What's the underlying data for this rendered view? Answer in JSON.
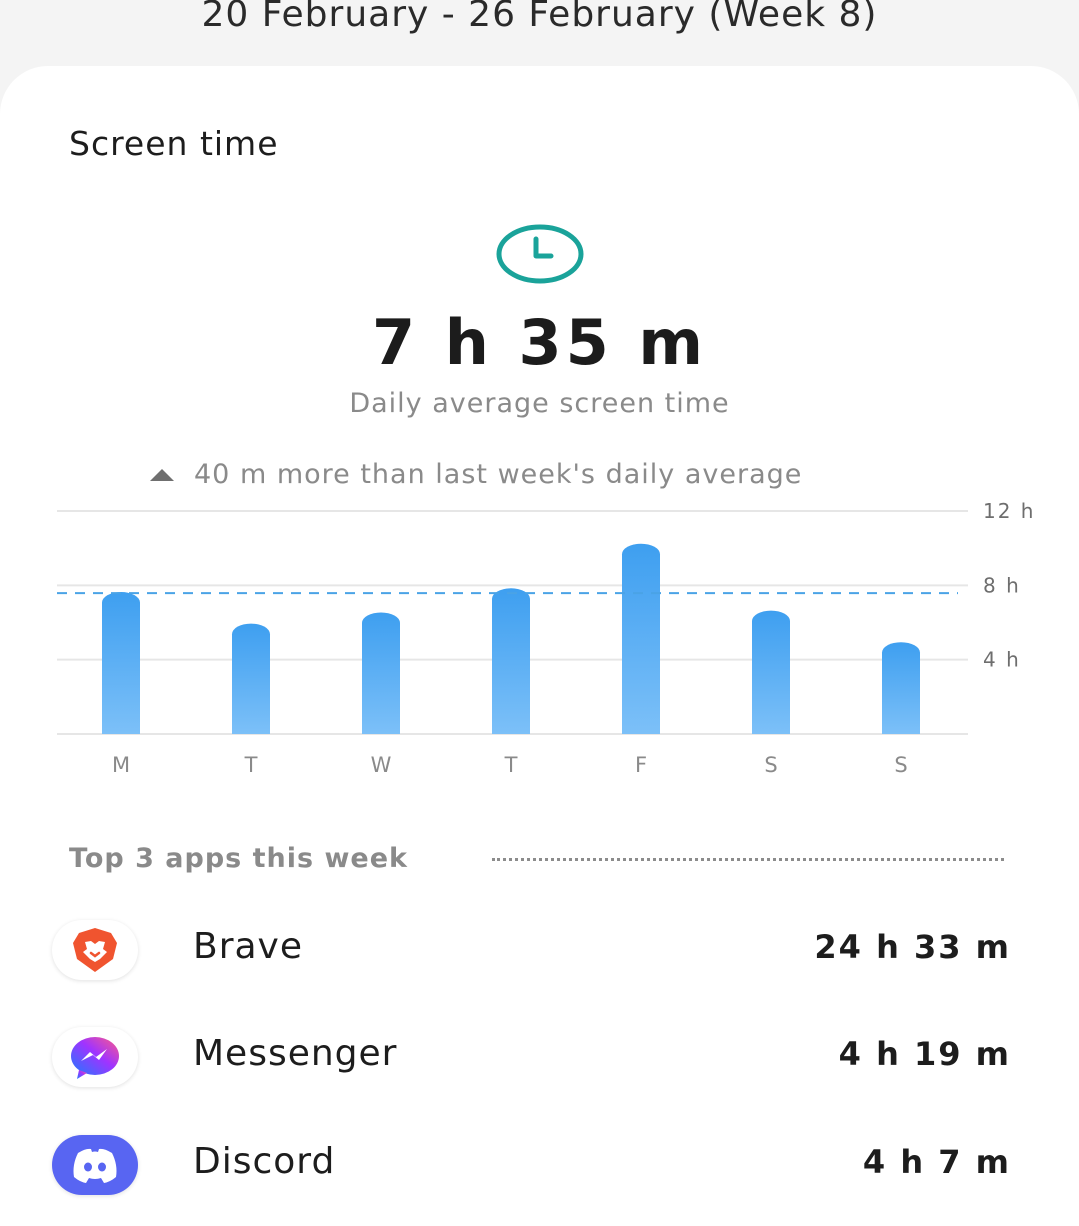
{
  "header": {
    "week_range": "20 February - 26 February (Week 8)"
  },
  "card": {
    "title": "Screen time",
    "clock_icon": "clock-icon",
    "daily_average": "7 h 35 m",
    "daily_average_label": "Daily average screen time",
    "comparison": "40 m more than last week's daily average",
    "comparison_icon": "triangle-up-icon"
  },
  "colors": {
    "accent_teal": "#1aa39a",
    "bar_blue": "#3e9ff0",
    "bar_light": "#7cc0f8",
    "avg_line": "#4aa3e6"
  },
  "chart_data": {
    "type": "bar",
    "categories": [
      "M",
      "T",
      "W",
      "T",
      "F",
      "S",
      "S"
    ],
    "values": [
      8.1,
      6.4,
      7.0,
      8.3,
      10.7,
      7.1,
      5.4
    ],
    "unit": "h",
    "ylim": [
      0,
      12
    ],
    "yticks": [
      4,
      8,
      12
    ],
    "ytick_labels": [
      "4 h",
      "8 h",
      "12 h"
    ],
    "average_line": 7.58,
    "grid": true
  },
  "top_apps": {
    "title": "Top 3 apps this week",
    "items": [
      {
        "name": "Brave",
        "time": "24 h 33 m",
        "icon": "brave-lion-icon"
      },
      {
        "name": "Messenger",
        "time": "4 h 19 m",
        "icon": "messenger-icon"
      },
      {
        "name": "Discord",
        "time": "4 h 7 m",
        "icon": "discord-icon"
      }
    ]
  }
}
